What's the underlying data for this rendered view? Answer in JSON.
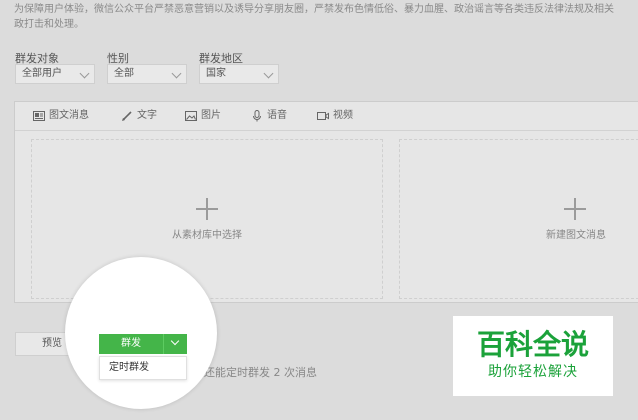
{
  "notice": "为保障用户体验，微信公众平台严禁恶意营销以及诱导分享朋友圈，严禁发布色情低俗、暴力血腥、政治谣言等各类违反法律法规及相关政打击和处理。",
  "filters": {
    "target": {
      "label": "群发对象",
      "value": "全部用户"
    },
    "gender": {
      "label": "性别",
      "value": "全部"
    },
    "region": {
      "label": "群发地区",
      "value": "国家"
    }
  },
  "tabs": [
    {
      "label": "图文消息",
      "icon": "news-icon"
    },
    {
      "label": "文字",
      "icon": "pen-icon"
    },
    {
      "label": "图片",
      "icon": "image-icon"
    },
    {
      "label": "语音",
      "icon": "microphone-icon"
    },
    {
      "label": "视频",
      "icon": "video-icon"
    }
  ],
  "cards": {
    "from_library": "从素材库中选择",
    "new_article": "新建图文消息"
  },
  "actions": {
    "preview": "预览",
    "send": "群发",
    "schedule": "定时群发",
    "quota": "还能定时群发 2 次消息"
  },
  "watermark": {
    "title": "百科全说",
    "subtitle": "助你轻松解决"
  },
  "colors": {
    "accent_green": "#44b549",
    "watermark_green": "#1ba23a"
  }
}
